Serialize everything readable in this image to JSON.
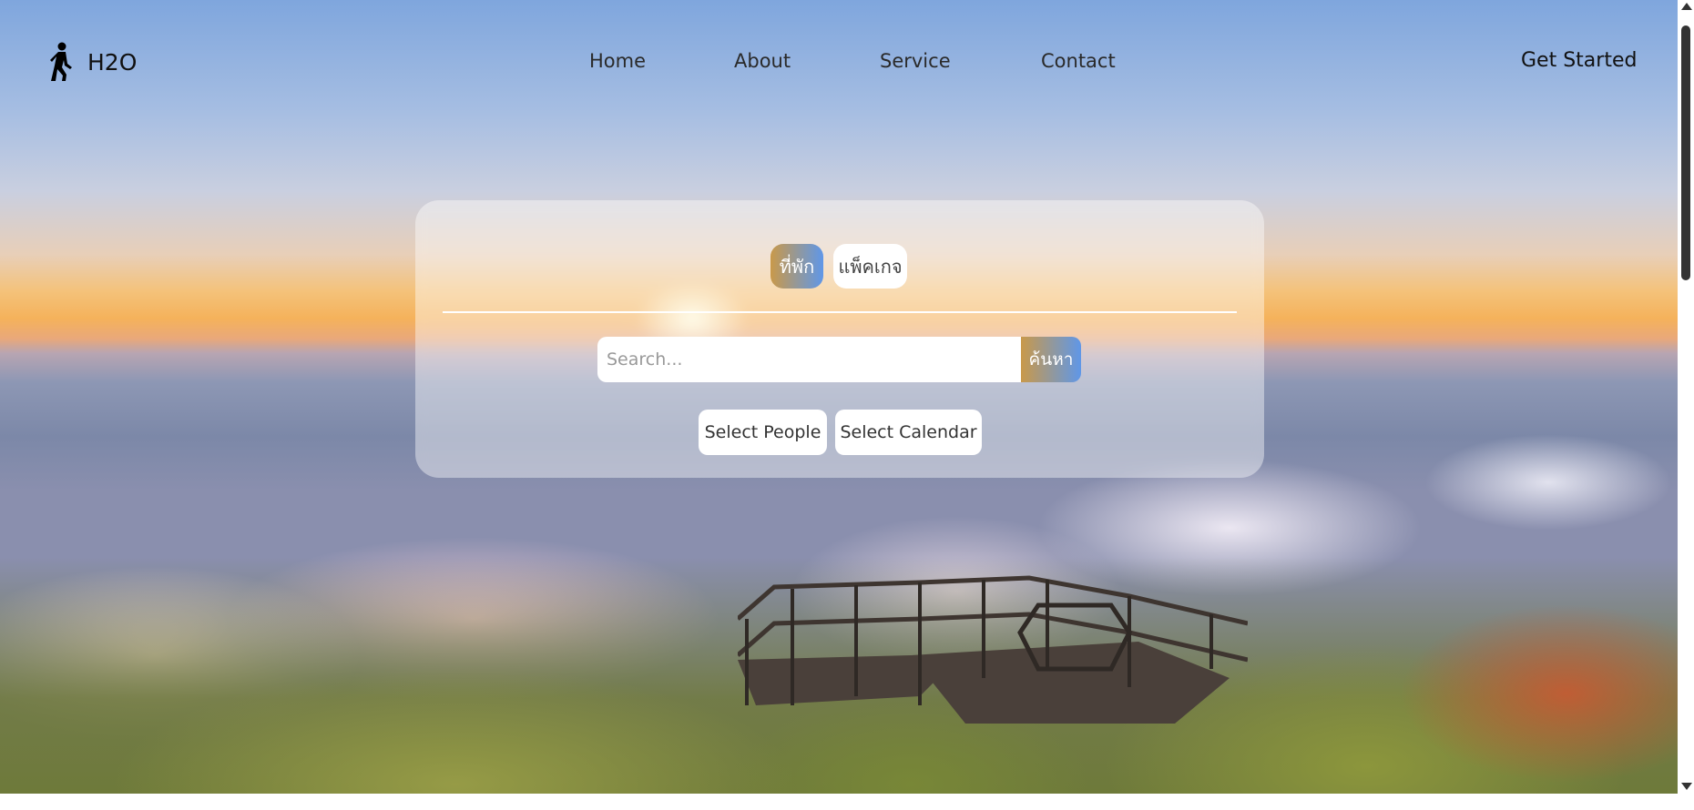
{
  "brand": {
    "name": "H2O",
    "icon": "walking-person-icon"
  },
  "nav": {
    "items": [
      {
        "label": "Home"
      },
      {
        "label": "About"
      },
      {
        "label": "Service"
      },
      {
        "label": "Contact"
      }
    ],
    "cta_label": "Get Started"
  },
  "search_card": {
    "tabs": [
      {
        "label": "ที่พัก",
        "active": true
      },
      {
        "label": "แพ็คเกจ",
        "active": false
      }
    ],
    "search": {
      "placeholder": "Search...",
      "value": "",
      "button_label": "ค้นหา"
    },
    "select_people_label": "Select People",
    "select_calendar_label": "Select Calendar"
  },
  "colors": {
    "accent_gradient_start": "#c9994a",
    "accent_gradient_end": "#5f97e8"
  }
}
